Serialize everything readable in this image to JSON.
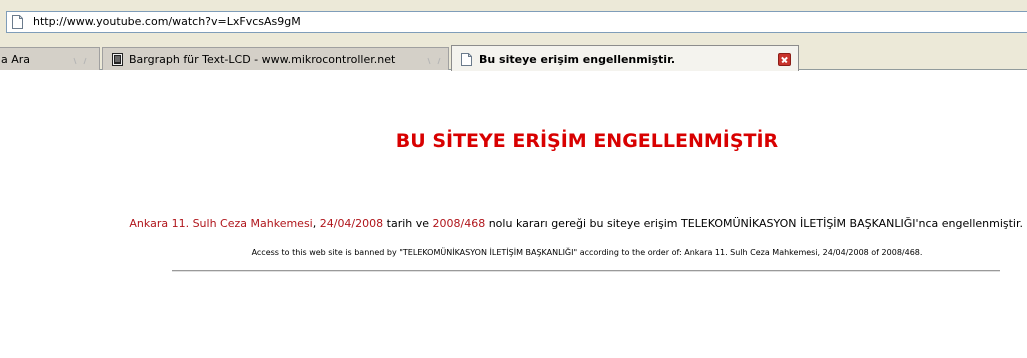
{
  "address_bar": {
    "url": "http://www.youtube.com/watch?v=LxFvcsAs9gM",
    "page_icon": "page-icon"
  },
  "tabs": [
    {
      "label": "a Ara",
      "icon": "",
      "active": false
    },
    {
      "label": "Bargraph für Text-LCD - www.mikrocontroller.net",
      "icon": "lcd-icon",
      "active": false
    },
    {
      "label": "Bu siteye erişim engellenmiştir.",
      "icon": "page-icon",
      "active": true
    }
  ],
  "content": {
    "heading": "BU SİTEYE ERİŞİM ENGELLENMİŞTİR",
    "court_name": "Ankara 11. Sulh Ceza Mahkemesi",
    "sep_comma": ", ",
    "decision_date": "24/04/2008",
    "text_tarih_ve": " tarih ve ",
    "decision_number": "2008/468",
    "text_rest": " nolu kararı gereği bu siteye erişim TELEKOMÜNİKASYON İLETİŞİM BAŞKANLIĞI'nca engellenmiştir.",
    "access_notice": "Access to this web site is banned by \"TELEKOMÜNİKASYON İLETİŞİM BAŞKANLIĞI\" according to the order of: Ankara 11. Sulh Ceza Mahkemesi, 24/04/2008 of 2008/468."
  },
  "colors": {
    "heading": "#d80000",
    "link_red": "#b0151b",
    "close_button": "#c8332c"
  }
}
